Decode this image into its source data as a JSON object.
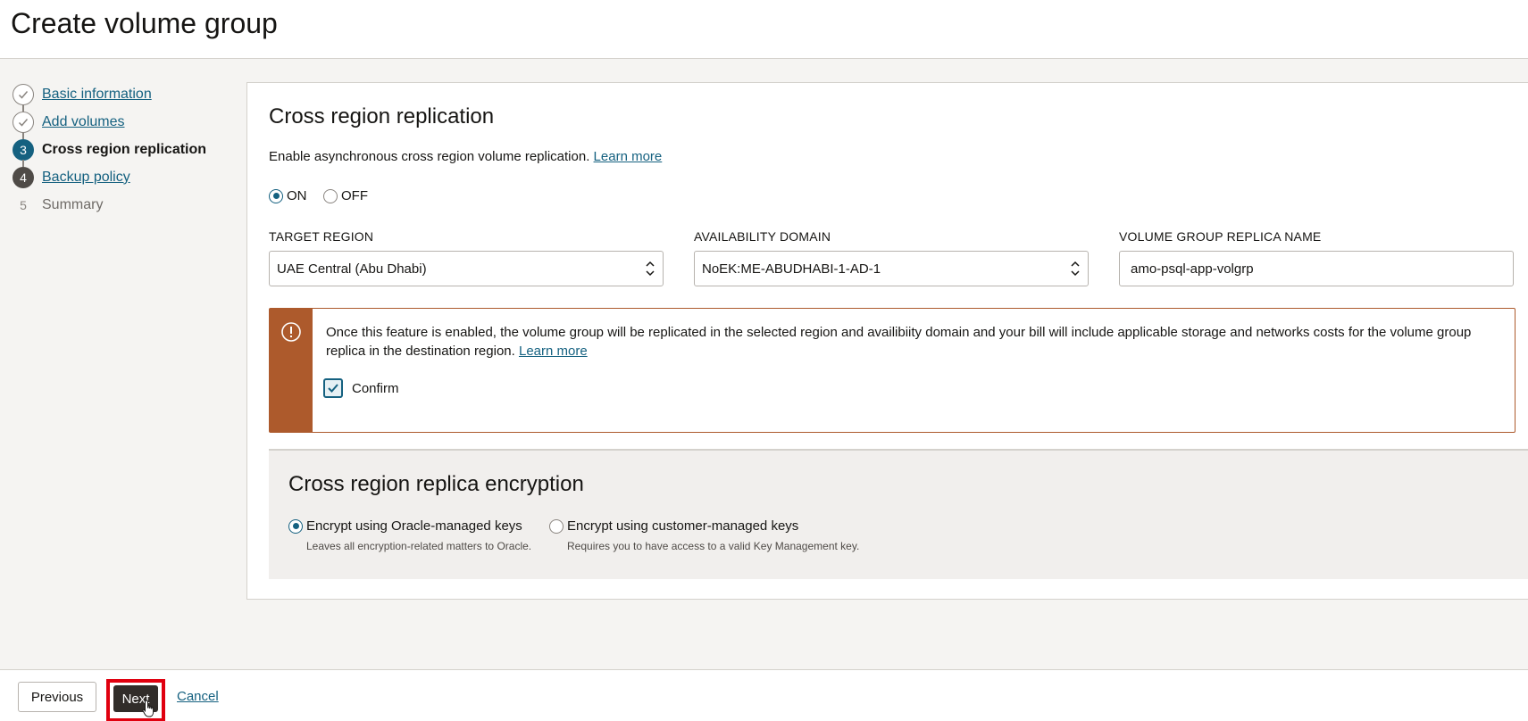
{
  "page": {
    "title": "Create volume group"
  },
  "steps": [
    {
      "number": "1",
      "label": "Basic information",
      "state": "done"
    },
    {
      "number": "2",
      "label": "Add volumes",
      "state": "done"
    },
    {
      "number": "3",
      "label": "Cross region replication",
      "state": "current"
    },
    {
      "number": "4",
      "label": "Backup policy",
      "state": "todo"
    },
    {
      "number": "5",
      "label": "Summary",
      "state": "disabled"
    }
  ],
  "replication": {
    "title": "Cross region replication",
    "description": "Enable asynchronous cross region volume replication.",
    "learn_more": "Learn more",
    "on_label": "ON",
    "off_label": "OFF",
    "selected": "ON",
    "target_region_label": "TARGET REGION",
    "target_region_value": "UAE Central (Abu Dhabi)",
    "availability_domain_label": "AVAILABILITY DOMAIN",
    "availability_domain_value": "NoEK:ME-ABUDHABI-1-AD-1",
    "replica_name_label": "VOLUME GROUP REPLICA NAME",
    "replica_name_value": "amo-psql-app-volgrp"
  },
  "warning": {
    "text": "Once this feature is enabled, the volume group will be replicated in the selected region and availibiity domain and your bill will include applicable storage and networks costs for the volume group replica in the destination region.",
    "learn_more": "Learn more",
    "confirm_label": "Confirm",
    "confirmed": true
  },
  "encryption": {
    "title": "Cross region replica encryption",
    "option_oracle": "Encrypt using Oracle-managed keys",
    "option_oracle_desc": "Leaves all encryption-related matters to Oracle.",
    "option_customer": "Encrypt using customer-managed keys",
    "option_customer_desc": "Requires you to have access to a valid Key Management key.",
    "selected": "oracle"
  },
  "footer": {
    "previous_label": "Previous",
    "next_label": "Next",
    "cancel_label": "Cancel"
  },
  "colors": {
    "accent": "#156180",
    "warning": "#ad5a2c",
    "highlight": "#e0000f",
    "primary_button": "#312d2a"
  }
}
